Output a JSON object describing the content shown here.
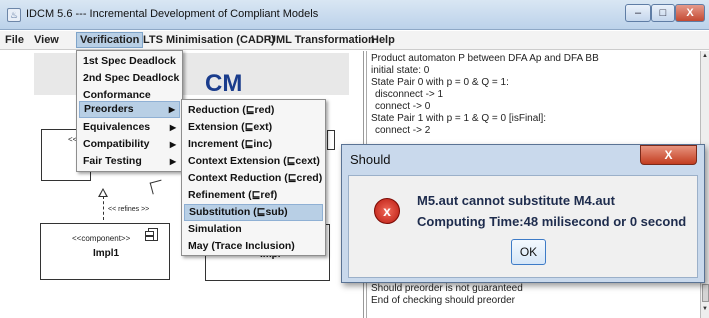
{
  "window": {
    "title": "IDCM 5.6  --- Incremental Development of Compliant Models",
    "minimize": "–",
    "maximize": "□",
    "close": "X"
  },
  "menubar": [
    "File",
    "View",
    "Verification",
    "LTS Minimisation (CADP)",
    "UML Transformation",
    "Help"
  ],
  "banner": {
    "text": "CM"
  },
  "diagram": {
    "refines_label": "<< refines >>",
    "stereotype_top": "<<",
    "component_stereotype": "<<component>>",
    "component_name": "Impl1",
    "right_component_partial": "Impl",
    "arrow_fragment": ">"
  },
  "verification_menu": [
    "1st Spec Deadlock",
    "2nd Spec Deadlock",
    "Conformance (conf)",
    "Preorders",
    "Equivalences",
    "Compatibility",
    "Fair Testing"
  ],
  "preorders_submenu": [
    "Reduction (⊑red)",
    "Extension (⊑ext)",
    "Increment (⊑inc)",
    "Context Extension (⊑cext)",
    "Context Reduction (⊑cred)",
    "Refinement (⊑ref)",
    "Substitution (⊑sub)",
    "Simulation",
    "May (Trace Inclusion)"
  ],
  "output": {
    "lines_top": [
      "Product automaton P between DFA Ap and DFA BB",
      "initial state: 0",
      "State Pair 0 with p = 0 & Q = 1:",
      "  disconnect -> 1",
      "  connect -> 0",
      "State Pair 1 with p = 1 & Q = 0 [isFinal]:",
      "  connect -> 2"
    ],
    "lines_bottom": [
      "Should preorder is not guaranteed",
      "End of checking should preorder"
    ]
  },
  "dialog": {
    "title": "Should",
    "close": "X",
    "message": "M5.aut cannot substitute M4.aut",
    "computing_time": "Computing Time:48 milisecond or 0 second",
    "ok": "OK"
  }
}
